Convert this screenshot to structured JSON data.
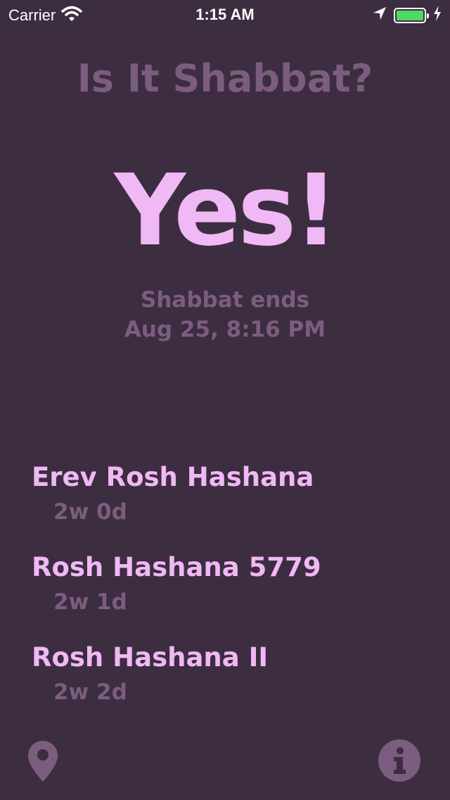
{
  "status_bar": {
    "carrier": "Carrier",
    "time": "1:15 AM",
    "battery_level": 1.0,
    "battery_color": "#4cd964"
  },
  "title": "Is It Shabbat?",
  "answer": "Yes!",
  "ends": {
    "label": "Shabbat ends",
    "time": "Aug 25, 8:16 PM"
  },
  "upcoming": [
    {
      "name": "Erev Rosh Hashana",
      "countdown": "2w 0d"
    },
    {
      "name": "Rosh Hashana 5779",
      "countdown": "2w 1d"
    },
    {
      "name": "Rosh Hashana II",
      "countdown": "2w 2d"
    }
  ],
  "toolbar": {
    "location_icon": "location-pin-icon",
    "info_icon": "info-icon"
  },
  "colors": {
    "background": "#3d2d40",
    "accent": "#f0b8f5",
    "muted": "#7b5d7f"
  }
}
